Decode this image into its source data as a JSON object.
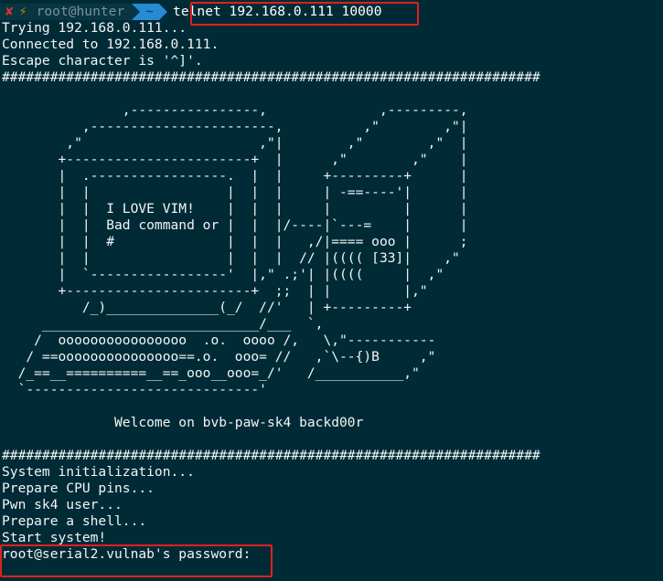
{
  "prompt": {
    "status_icon": "x-icon",
    "power_icon": "lightning-icon",
    "status_glyph": "✘",
    "power_glyph": "⚡",
    "user_host": "root@hunter",
    "dir": "~",
    "command": "telnet 192.168.0.111 10000"
  },
  "output": {
    "lines": [
      "Trying 192.168.0.111...",
      "Connected to 192.168.0.111.",
      "Escape character is '^]'.",
      "###################################################################"
    ]
  },
  "banner": {
    "art": [
      "",
      "               ,----------------,              ,---------,",
      "          ,-----------------------,          ,\"        ,\"|",
      "        ,\"                      ,\"|        ,\"        ,\"  |",
      "       +-----------------------+  |      ,\"        ,\"    |",
      "       |  .-----------------.  |  |     +---------+      |",
      "       |  |                 |  |  |     | -==----'|      |",
      "       |  |  I LOVE VIM!    |  |  |     |         |      |",
      "       |  |  Bad command or |  |  |/----|`---=    |      |",
      "       |  |  #              |  |  |   ,/|==== ooo |      ;",
      "       |  |                 |  |  |  // |(((( [33]|    ,\"",
      "       |  `-----------------'  |,\" .;'| |((((     |  ,\"",
      "       +-----------------------+  ;;  | |         |,\"",
      "          /_)______________(_/  //'   | +---------+",
      "     ___________________________/___  `,",
      "    /  oooooooooooooooo  .o.  oooo /,   \\,\"-----------",
      "   / ==ooooooooooooooo==.o.  ooo= //   ,`\\--{)B     ,\"",
      "  /_==__==========__==_ooo__ooo=_/'   /___________,\"",
      "  `-----------------------------'",
      "",
      "              Welcome on bvb-paw-sk4 backd00r",
      "",
      "###################################################################"
    ]
  },
  "boot": {
    "lines": [
      "System initialization...",
      "Prepare CPU pins...",
      "Pwn sk4 user...",
      "Prepare a shell...",
      "Start system!"
    ]
  },
  "login": {
    "password_prompt": "root@serial2.vulnab's password:"
  },
  "colors": {
    "background": "#002b36",
    "highlight_box": "#e0201e",
    "status_red": "#dc322f",
    "bolt_yellow": "#b58900",
    "dir_segment_blue": "#268bd2"
  }
}
